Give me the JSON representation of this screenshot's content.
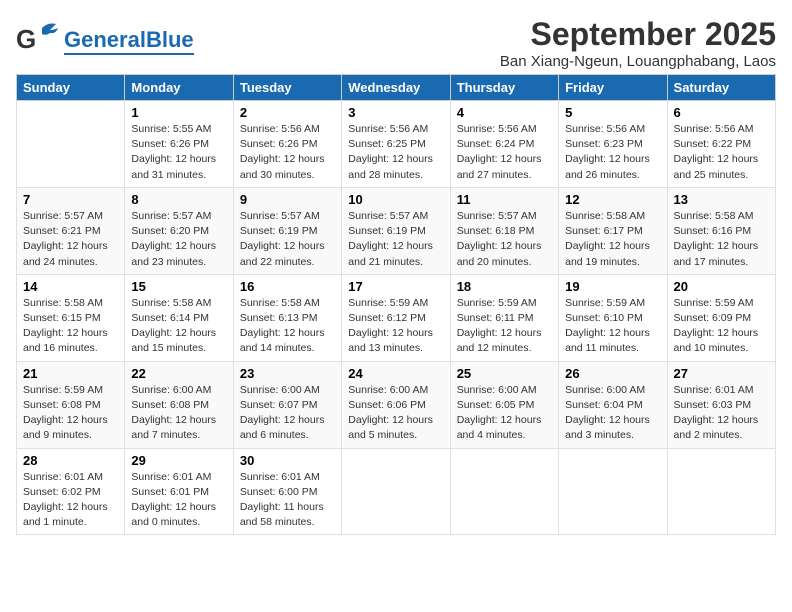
{
  "header": {
    "logo_general": "General",
    "logo_blue": "Blue",
    "main_title": "September 2025",
    "subtitle": "Ban Xiang-Ngeun, Louangphabang, Laos"
  },
  "days_of_week": [
    "Sunday",
    "Monday",
    "Tuesday",
    "Wednesday",
    "Thursday",
    "Friday",
    "Saturday"
  ],
  "weeks": [
    [
      {
        "day": "",
        "info": ""
      },
      {
        "day": "1",
        "info": "Sunrise: 5:55 AM\nSunset: 6:26 PM\nDaylight: 12 hours\nand 31 minutes."
      },
      {
        "day": "2",
        "info": "Sunrise: 5:56 AM\nSunset: 6:26 PM\nDaylight: 12 hours\nand 30 minutes."
      },
      {
        "day": "3",
        "info": "Sunrise: 5:56 AM\nSunset: 6:25 PM\nDaylight: 12 hours\nand 28 minutes."
      },
      {
        "day": "4",
        "info": "Sunrise: 5:56 AM\nSunset: 6:24 PM\nDaylight: 12 hours\nand 27 minutes."
      },
      {
        "day": "5",
        "info": "Sunrise: 5:56 AM\nSunset: 6:23 PM\nDaylight: 12 hours\nand 26 minutes."
      },
      {
        "day": "6",
        "info": "Sunrise: 5:56 AM\nSunset: 6:22 PM\nDaylight: 12 hours\nand 25 minutes."
      }
    ],
    [
      {
        "day": "7",
        "info": "Sunrise: 5:57 AM\nSunset: 6:21 PM\nDaylight: 12 hours\nand 24 minutes."
      },
      {
        "day": "8",
        "info": "Sunrise: 5:57 AM\nSunset: 6:20 PM\nDaylight: 12 hours\nand 23 minutes."
      },
      {
        "day": "9",
        "info": "Sunrise: 5:57 AM\nSunset: 6:19 PM\nDaylight: 12 hours\nand 22 minutes."
      },
      {
        "day": "10",
        "info": "Sunrise: 5:57 AM\nSunset: 6:19 PM\nDaylight: 12 hours\nand 21 minutes."
      },
      {
        "day": "11",
        "info": "Sunrise: 5:57 AM\nSunset: 6:18 PM\nDaylight: 12 hours\nand 20 minutes."
      },
      {
        "day": "12",
        "info": "Sunrise: 5:58 AM\nSunset: 6:17 PM\nDaylight: 12 hours\nand 19 minutes."
      },
      {
        "day": "13",
        "info": "Sunrise: 5:58 AM\nSunset: 6:16 PM\nDaylight: 12 hours\nand 17 minutes."
      }
    ],
    [
      {
        "day": "14",
        "info": "Sunrise: 5:58 AM\nSunset: 6:15 PM\nDaylight: 12 hours\nand 16 minutes."
      },
      {
        "day": "15",
        "info": "Sunrise: 5:58 AM\nSunset: 6:14 PM\nDaylight: 12 hours\nand 15 minutes."
      },
      {
        "day": "16",
        "info": "Sunrise: 5:58 AM\nSunset: 6:13 PM\nDaylight: 12 hours\nand 14 minutes."
      },
      {
        "day": "17",
        "info": "Sunrise: 5:59 AM\nSunset: 6:12 PM\nDaylight: 12 hours\nand 13 minutes."
      },
      {
        "day": "18",
        "info": "Sunrise: 5:59 AM\nSunset: 6:11 PM\nDaylight: 12 hours\nand 12 minutes."
      },
      {
        "day": "19",
        "info": "Sunrise: 5:59 AM\nSunset: 6:10 PM\nDaylight: 12 hours\nand 11 minutes."
      },
      {
        "day": "20",
        "info": "Sunrise: 5:59 AM\nSunset: 6:09 PM\nDaylight: 12 hours\nand 10 minutes."
      }
    ],
    [
      {
        "day": "21",
        "info": "Sunrise: 5:59 AM\nSunset: 6:08 PM\nDaylight: 12 hours\nand 9 minutes."
      },
      {
        "day": "22",
        "info": "Sunrise: 6:00 AM\nSunset: 6:08 PM\nDaylight: 12 hours\nand 7 minutes."
      },
      {
        "day": "23",
        "info": "Sunrise: 6:00 AM\nSunset: 6:07 PM\nDaylight: 12 hours\nand 6 minutes."
      },
      {
        "day": "24",
        "info": "Sunrise: 6:00 AM\nSunset: 6:06 PM\nDaylight: 12 hours\nand 5 minutes."
      },
      {
        "day": "25",
        "info": "Sunrise: 6:00 AM\nSunset: 6:05 PM\nDaylight: 12 hours\nand 4 minutes."
      },
      {
        "day": "26",
        "info": "Sunrise: 6:00 AM\nSunset: 6:04 PM\nDaylight: 12 hours\nand 3 minutes."
      },
      {
        "day": "27",
        "info": "Sunrise: 6:01 AM\nSunset: 6:03 PM\nDaylight: 12 hours\nand 2 minutes."
      }
    ],
    [
      {
        "day": "28",
        "info": "Sunrise: 6:01 AM\nSunset: 6:02 PM\nDaylight: 12 hours\nand 1 minute."
      },
      {
        "day": "29",
        "info": "Sunrise: 6:01 AM\nSunset: 6:01 PM\nDaylight: 12 hours\nand 0 minutes."
      },
      {
        "day": "30",
        "info": "Sunrise: 6:01 AM\nSunset: 6:00 PM\nDaylight: 11 hours\nand 58 minutes."
      },
      {
        "day": "",
        "info": ""
      },
      {
        "day": "",
        "info": ""
      },
      {
        "day": "",
        "info": ""
      },
      {
        "day": "",
        "info": ""
      }
    ]
  ]
}
